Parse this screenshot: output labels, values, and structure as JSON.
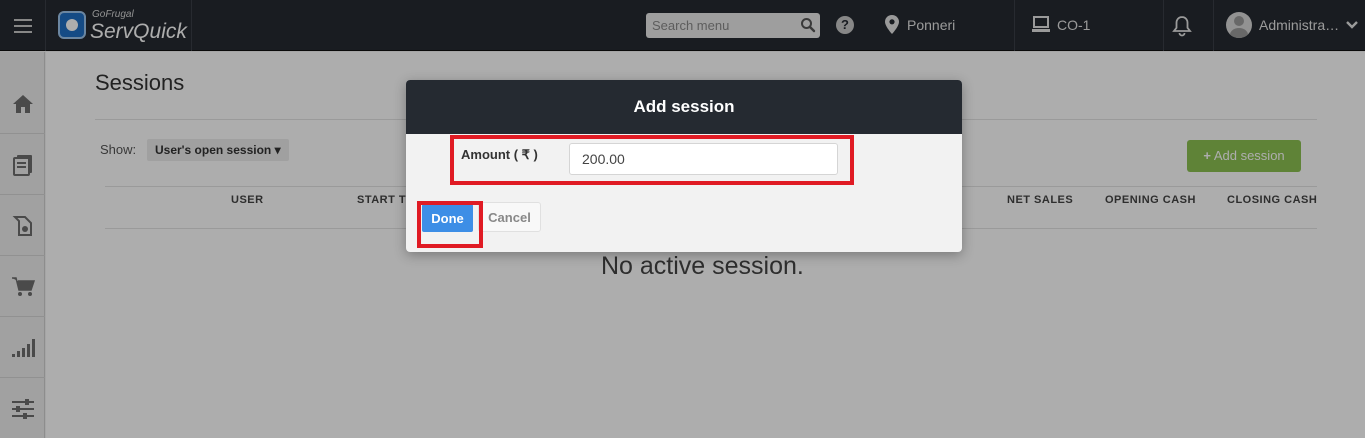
{
  "header": {
    "logo_small": "GoFrugal",
    "logo_big": "ServQuick",
    "search_placeholder": "Search menu",
    "location": "Ponneri",
    "counter": "CO-1",
    "user": "Administra…"
  },
  "sidebar": {
    "items": [
      {
        "icon": "home-icon"
      },
      {
        "icon": "catalog-icon"
      },
      {
        "icon": "shopping-bag-icon"
      },
      {
        "icon": "cart-icon"
      },
      {
        "icon": "signal-bars-icon"
      },
      {
        "icon": "sliders-icon"
      }
    ]
  },
  "page": {
    "title": "Sessions",
    "show_label": "Show:",
    "filter_value": "User's open session",
    "add_button": "Add session",
    "columns": [
      "USER",
      "START TI",
      "NET SALES",
      "OPENING CASH",
      "CLOSING CASH"
    ],
    "empty_message": "No active session."
  },
  "modal": {
    "title": "Add session",
    "amount_label": "Amount ( ₹ )",
    "amount_value": "200.00",
    "done_label": "Done",
    "cancel_label": "Cancel"
  },
  "colors": {
    "topbar": "#252a31",
    "accent_green": "#8cc152",
    "done_blue": "#3d8ee6",
    "highlight_red": "#e01b24"
  }
}
